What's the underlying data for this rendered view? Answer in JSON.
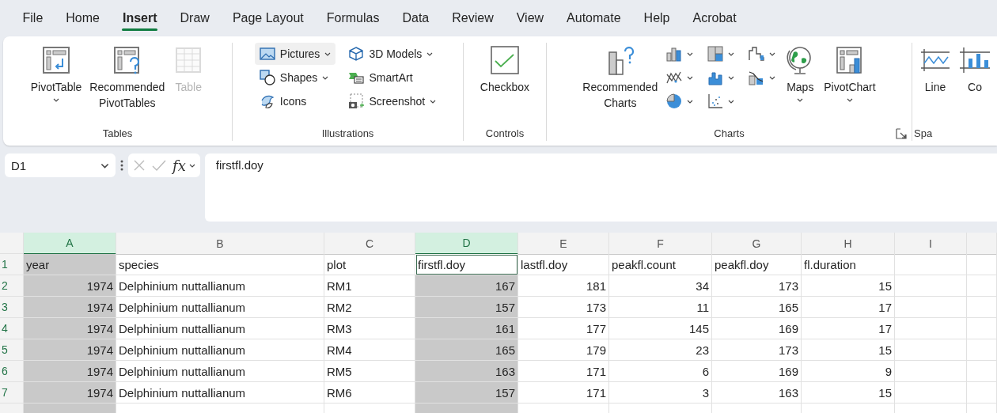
{
  "tabs": [
    {
      "label": "File",
      "selected": false
    },
    {
      "label": "Home",
      "selected": false
    },
    {
      "label": "Insert",
      "selected": true
    },
    {
      "label": "Draw",
      "selected": false
    },
    {
      "label": "Page Layout",
      "selected": false
    },
    {
      "label": "Formulas",
      "selected": false
    },
    {
      "label": "Data",
      "selected": false
    },
    {
      "label": "Review",
      "selected": false
    },
    {
      "label": "View",
      "selected": false
    },
    {
      "label": "Automate",
      "selected": false
    },
    {
      "label": "Help",
      "selected": false
    },
    {
      "label": "Acrobat",
      "selected": false
    }
  ],
  "ribbon": {
    "groups": [
      {
        "label": "Tables",
        "launcher": false,
        "items": [
          {
            "kind": "large",
            "label": "PivotTable",
            "dropdown": true,
            "disabled": false
          },
          {
            "kind": "large",
            "label": "Recommended\nPivotTables",
            "dropdown": false,
            "disabled": false
          },
          {
            "kind": "large",
            "label": "Table",
            "dropdown": false,
            "disabled": true
          }
        ]
      },
      {
        "label": "Illustrations",
        "launcher": false,
        "items": [
          {
            "kind": "small",
            "label": "Pictures",
            "dropdown": true,
            "hovered": true
          },
          {
            "kind": "small",
            "label": "Shapes",
            "dropdown": true,
            "hovered": false
          },
          {
            "kind": "small",
            "label": "Icons",
            "dropdown": false,
            "hovered": false
          },
          {
            "kind": "small",
            "label": "3D Models",
            "dropdown": true,
            "hovered": false
          },
          {
            "kind": "small",
            "label": "SmartArt",
            "dropdown": false,
            "hovered": false
          },
          {
            "kind": "small",
            "label": "Screenshot",
            "dropdown": true,
            "hovered": false
          }
        ]
      },
      {
        "label": "Controls",
        "launcher": false,
        "items": [
          {
            "kind": "large",
            "label": "Checkbox",
            "dropdown": false,
            "disabled": false
          }
        ]
      },
      {
        "label": "Charts",
        "launcher": true,
        "items": [
          {
            "kind": "large",
            "label": "Recommended\nCharts",
            "dropdown": false,
            "disabled": false
          },
          {
            "kind": "icon",
            "dropdown": true
          },
          {
            "kind": "icon",
            "dropdown": true
          },
          {
            "kind": "icon",
            "dropdown": true
          },
          {
            "kind": "icon",
            "dropdown": true
          },
          {
            "kind": "icon",
            "dropdown": true
          },
          {
            "kind": "icon",
            "dropdown": true
          },
          {
            "kind": "icon",
            "dropdown": true
          },
          {
            "kind": "icon",
            "dropdown": true
          },
          {
            "kind": "large",
            "label": "Maps",
            "dropdown": true,
            "disabled": false
          },
          {
            "kind": "large",
            "label": "PivotChart",
            "dropdown": true,
            "disabled": false
          }
        ]
      },
      {
        "label": "Spa",
        "launcher": false,
        "items": [
          {
            "kind": "large",
            "label": "Line",
            "dropdown": false,
            "disabled": false
          },
          {
            "kind": "large",
            "label": "Co",
            "dropdown": false,
            "disabled": false
          }
        ]
      }
    ]
  },
  "formula_bar": {
    "name_box": "D1",
    "function_label": "fx",
    "formula": "firstfl.doy"
  },
  "grid": {
    "columns": [
      {
        "label": "A",
        "selected": true,
        "numeric": true
      },
      {
        "label": "B",
        "selected": false,
        "numeric": false
      },
      {
        "label": "C",
        "selected": false,
        "numeric": false
      },
      {
        "label": "D",
        "selected": true,
        "numeric": true
      },
      {
        "label": "E",
        "selected": false,
        "numeric": true
      },
      {
        "label": "F",
        "selected": false,
        "numeric": true
      },
      {
        "label": "G",
        "selected": false,
        "numeric": true
      },
      {
        "label": "H",
        "selected": false,
        "numeric": true
      },
      {
        "label": "I",
        "selected": false
      }
    ],
    "rows": [
      {
        "number": "1",
        "kind": "header",
        "cells": [
          "year",
          "species",
          "plot",
          "firstfl.doy",
          "lastfl.doy",
          "peakfl.count",
          "peakfl.doy",
          "fl.duration"
        ],
        "active": [
          false,
          false,
          false,
          true,
          false,
          false,
          false,
          false
        ]
      },
      {
        "number": "2",
        "kind": "data",
        "cells": [
          "1974",
          "Delphinium nuttallianum",
          "RM1",
          "167",
          "181",
          "34",
          "173",
          "15"
        ]
      },
      {
        "number": "3",
        "kind": "data",
        "cells": [
          "1974",
          "Delphinium nuttallianum",
          "RM2",
          "157",
          "173",
          "11",
          "165",
          "17"
        ]
      },
      {
        "number": "4",
        "kind": "data",
        "cells": [
          "1974",
          "Delphinium nuttallianum",
          "RM3",
          "161",
          "177",
          "145",
          "169",
          "17"
        ]
      },
      {
        "number": "5",
        "kind": "data",
        "cells": [
          "1974",
          "Delphinium nuttallianum",
          "RM4",
          "165",
          "179",
          "23",
          "173",
          "15"
        ]
      },
      {
        "number": "6",
        "kind": "data",
        "cells": [
          "1974",
          "Delphinium nuttallianum",
          "RM5",
          "163",
          "171",
          "6",
          "169",
          "9"
        ]
      },
      {
        "number": "7",
        "kind": "data",
        "cells": [
          "1974",
          "Delphinium nuttallianum",
          "RM6",
          "157",
          "171",
          "3",
          "163",
          "15"
        ]
      }
    ]
  }
}
